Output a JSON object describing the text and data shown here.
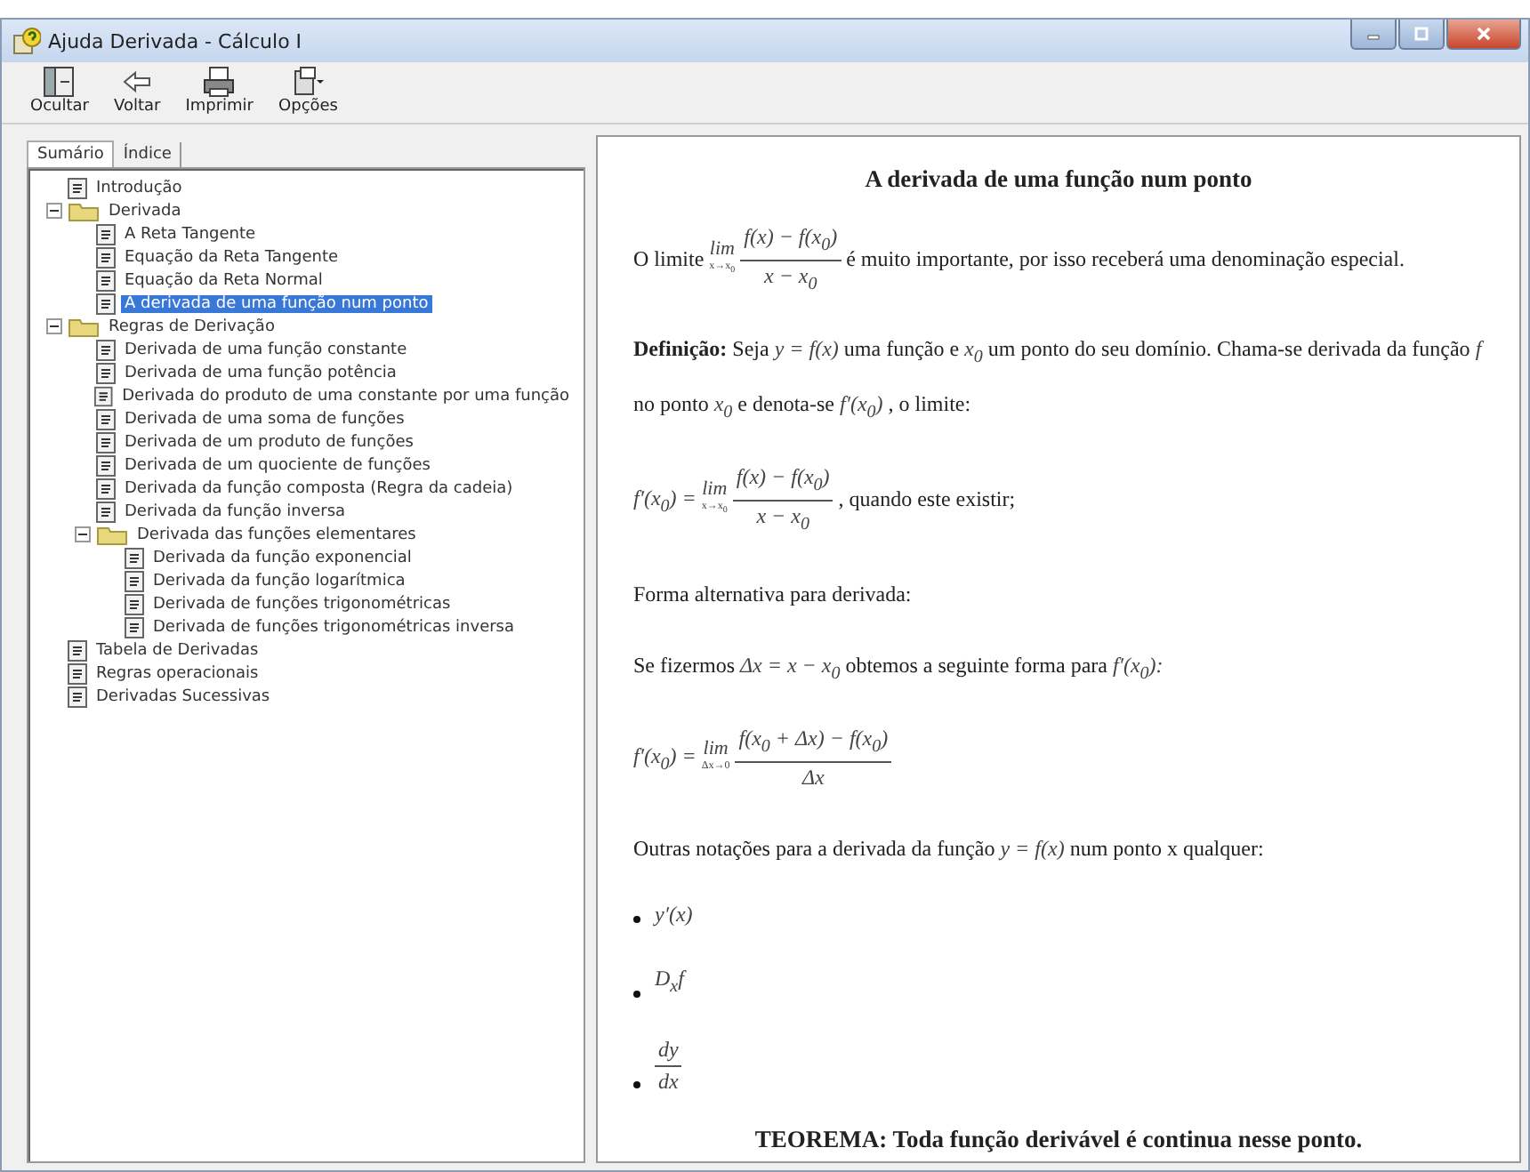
{
  "window": {
    "title": "Ajuda Derivada - Cálculo I"
  },
  "toolbar": [
    {
      "label": "Ocultar",
      "kind": "hide"
    },
    {
      "label": "Voltar",
      "kind": "back"
    },
    {
      "label": "Imprimir",
      "kind": "print"
    },
    {
      "label": "Opções",
      "kind": "options"
    }
  ],
  "tabs": [
    {
      "label": "Sumário",
      "selected": true
    },
    {
      "label": "Índice",
      "selected": false
    }
  ],
  "tree": [
    {
      "label": "Introdução",
      "kind": "page",
      "selected": false
    },
    {
      "label": "Derivada",
      "kind": "folder",
      "expanded": true,
      "selected": false,
      "children": [
        {
          "label": "A Reta Tangente",
          "kind": "page",
          "selected": false
        },
        {
          "label": "Equação da Reta Tangente",
          "kind": "page",
          "selected": false
        },
        {
          "label": "Equação da Reta Normal",
          "kind": "page",
          "selected": false
        },
        {
          "label": "A derivada de uma função num ponto",
          "kind": "page",
          "selected": true
        }
      ]
    },
    {
      "label": "Regras de Derivação",
      "kind": "folder",
      "expanded": true,
      "selected": false,
      "children": [
        {
          "label": "Derivada de uma função constante",
          "kind": "page",
          "selected": false
        },
        {
          "label": "Derivada de uma função potência",
          "kind": "page",
          "selected": false
        },
        {
          "label": "Derivada do produto de uma constante por uma função",
          "kind": "page",
          "selected": false
        },
        {
          "label": "Derivada de uma soma de funções",
          "kind": "page",
          "selected": false
        },
        {
          "label": "Derivada de um produto de funções",
          "kind": "page",
          "selected": false
        },
        {
          "label": "Derivada de um quociente de funções",
          "kind": "page",
          "selected": false
        },
        {
          "label": "Derivada da função composta (Regra da cadeia)",
          "kind": "page",
          "selected": false
        },
        {
          "label": "Derivada da função inversa",
          "kind": "page",
          "selected": false
        },
        {
          "label": "Derivada das funções elementares",
          "kind": "folder",
          "expanded": true,
          "selected": false,
          "children": [
            {
              "label": "Derivada da função exponencial",
              "kind": "page",
              "selected": false
            },
            {
              "label": "Derivada da função logarítmica",
              "kind": "page",
              "selected": false
            },
            {
              "label": "Derivada de funções trigonométricas",
              "kind": "page",
              "selected": false
            },
            {
              "label": "Derivada de funções trigonométricas inversa",
              "kind": "page",
              "selected": false
            }
          ]
        }
      ]
    },
    {
      "label": "Tabela de Derivadas",
      "kind": "page",
      "selected": false
    },
    {
      "label": "Regras operacionais",
      "kind": "page",
      "selected": false
    },
    {
      "label": "Derivadas Sucessivas",
      "kind": "page",
      "selected": false
    }
  ],
  "content": [
    {
      "kind": "heading",
      "text": "A derivada de uma função num ponto"
    },
    {
      "kind": "paragraph",
      "parts": [
        {
          "kind": "text",
          "text": "O limite"
        },
        {
          "kind": "limfrac",
          "lim": "lim",
          "under": "x→x$_{0}$",
          "num": "f(x) − f(x$_{0}$)",
          "den": "x − x$_{0}$"
        },
        {
          "kind": "text",
          "text": "é muito importante, por isso receberá uma denominação especial."
        }
      ]
    },
    {
      "kind": "paragraph",
      "parts": [
        {
          "kind": "bold",
          "text": "Definição:"
        },
        {
          "kind": "text",
          "text": "Seja"
        },
        {
          "kind": "math",
          "text": "y = f(x)"
        },
        {
          "kind": "text",
          "text": "uma função e"
        },
        {
          "kind": "math",
          "text": "x$_{0}$"
        },
        {
          "kind": "text",
          "text": "um ponto do seu domínio. Chama-se derivada da função"
        },
        {
          "kind": "math",
          "text": "f"
        },
        {
          "kind": "text",
          "text": "no ponto"
        },
        {
          "kind": "math",
          "text": "x$_{0}$"
        },
        {
          "kind": "text",
          "text": "e denota-se"
        },
        {
          "kind": "math",
          "text": "f′(x$_{0}$)"
        },
        {
          "kind": "text",
          "text": ", o limite:"
        }
      ]
    },
    {
      "kind": "formula",
      "parts": [
        {
          "kind": "math",
          "text": "f′(x$_{0}$) ="
        },
        {
          "kind": "limfrac",
          "lim": "lim",
          "under": "x→x$_{0}$",
          "num": "f(x) − f(x$_{0}$)",
          "den": "x − x$_{0}$"
        },
        {
          "kind": "text",
          "text": ", quando este existir;"
        }
      ]
    },
    {
      "kind": "paragraph",
      "parts": [
        {
          "kind": "text",
          "text": "Forma alternativa para derivada:"
        }
      ]
    },
    {
      "kind": "paragraph",
      "parts": [
        {
          "kind": "text",
          "text": "Se fizermos"
        },
        {
          "kind": "math",
          "text": "Δx = x − x$_{0}$"
        },
        {
          "kind": "text",
          "text": "obtemos a seguinte forma para"
        },
        {
          "kind": "math",
          "text": "f′(x$_{0}$):"
        }
      ]
    },
    {
      "kind": "formula",
      "parts": [
        {
          "kind": "math",
          "text": "f′(x$_{0}$) ="
        },
        {
          "kind": "limfrac",
          "lim": "lim",
          "under": "Δx→0",
          "num": "f(x$_{0}$ + Δx) − f(x$_{0}$)",
          "den": "Δx"
        }
      ]
    },
    {
      "kind": "paragraph",
      "parts": [
        {
          "kind": "text",
          "text": "Outras notações para a derivada da função"
        },
        {
          "kind": "math",
          "text": "y = f(x)"
        },
        {
          "kind": "text",
          "text": "num ponto x qualquer:"
        }
      ]
    },
    {
      "kind": "bullet",
      "parts": [
        {
          "kind": "math",
          "text": "y′(x)"
        }
      ]
    },
    {
      "kind": "bullet",
      "parts": [
        {
          "kind": "math",
          "text": "D$_{x}$f"
        }
      ]
    },
    {
      "kind": "bullet",
      "parts": [
        {
          "kind": "limfrac",
          "num": "dy",
          "den": "dx"
        }
      ]
    },
    {
      "kind": "theorem",
      "text": "TEOREMA: Toda função derivável é continua nesse ponto."
    }
  ]
}
